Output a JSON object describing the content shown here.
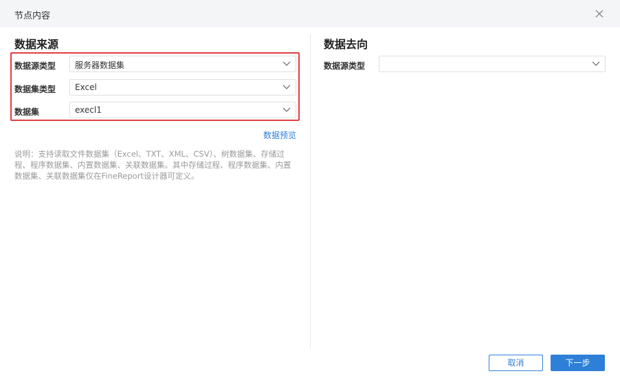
{
  "dialog": {
    "title": "节点内容"
  },
  "source": {
    "title": "数据来源",
    "fields": [
      {
        "label": "数据源类型",
        "value": "服务器数据集"
      },
      {
        "label": "数据集类型",
        "value": "Excel"
      },
      {
        "label": "数据集",
        "value": "execl1"
      }
    ],
    "preview_link": "数据预览",
    "note": "说明：支持读取文件数据集（Excel、TXT、XML、CSV）、树数据集、存储过程、程序数据集、内置数据集、关联数据集。其中存储过程、程序数据集、内置数据集、关联数据集仅在FineReport设计器可定义。"
  },
  "target": {
    "title": "数据去向",
    "fields": [
      {
        "label": "数据源类型",
        "value": ""
      }
    ]
  },
  "footer": {
    "cancel_label": "取消",
    "next_label": "下一步"
  },
  "colors": {
    "accent": "#2e7fd8",
    "highlight_border": "#e23c3c",
    "header_bg": "#f4f5f7"
  }
}
